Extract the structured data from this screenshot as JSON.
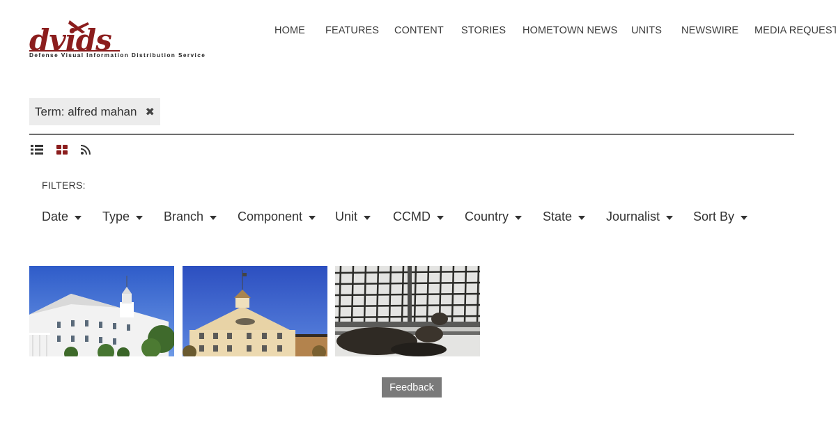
{
  "header": {
    "logo_text": "dvids",
    "logo_tagline": "Defense Visual Information Distribution Service",
    "nav": [
      "HOME",
      "FEATURES",
      "CONTENT",
      "STORIES",
      "HOMETOWN NEWS",
      "UNITS",
      "NEWSWIRE",
      "MEDIA REQUESTS"
    ]
  },
  "search": {
    "term_label": "Term: alfred mahan",
    "remove_icon": "close-icon"
  },
  "view_toggles": [
    "list-view-icon",
    "grid-view-icon",
    "rss-icon"
  ],
  "filters": {
    "label": "FILTERS:",
    "items": [
      "Date",
      "Type",
      "Branch",
      "Component",
      "Unit",
      "CCMD",
      "Country",
      "State",
      "Journalist",
      "Sort By"
    ]
  },
  "results": [
    {
      "subject": "white-building-photo"
    },
    {
      "subject": "hall-cupola-photo"
    },
    {
      "subject": "sea-lion-net-photo"
    }
  ],
  "feedback_label": "Feedback",
  "colors": {
    "brand": "#8b1d1d",
    "rule": "#6f6f6f",
    "chip_bg": "#ececec",
    "feedback_bg": "#7a7a7a"
  }
}
